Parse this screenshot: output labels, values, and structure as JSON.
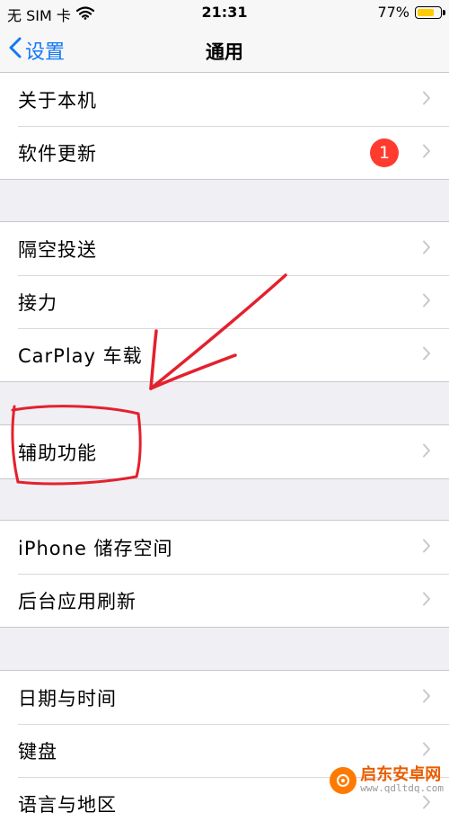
{
  "status_bar": {
    "carrier": "无 SIM 卡",
    "time": "21:31",
    "battery_percent": "77%",
    "battery_level": 0.77,
    "battery_color": "#ffcc00"
  },
  "nav": {
    "back_label": "设置",
    "title": "通用",
    "accent_color": "#1479f5"
  },
  "groups": [
    {
      "rows": [
        {
          "label": "关于本机"
        },
        {
          "label": "软件更新",
          "badge": "1"
        }
      ]
    },
    {
      "rows": [
        {
          "label": "隔空投送"
        },
        {
          "label": "接力"
        },
        {
          "label": "CarPlay 车载"
        }
      ]
    },
    {
      "rows": [
        {
          "label": "辅助功能"
        }
      ]
    },
    {
      "rows": [
        {
          "label": "iPhone 储存空间"
        },
        {
          "label": "后台应用刷新"
        }
      ]
    },
    {
      "rows": [
        {
          "label": "日期与时间"
        },
        {
          "label": "键盘"
        },
        {
          "label": "语言与地区"
        }
      ]
    }
  ],
  "icons": {
    "wifi": "wifi-icon",
    "battery": "battery-icon",
    "back": "chevron-left-icon",
    "disclosure": "chevron-right-icon"
  },
  "annotation_color": "#e3212d",
  "watermark": {
    "name": "启东安卓网",
    "url": "www.qdltdq.com"
  }
}
